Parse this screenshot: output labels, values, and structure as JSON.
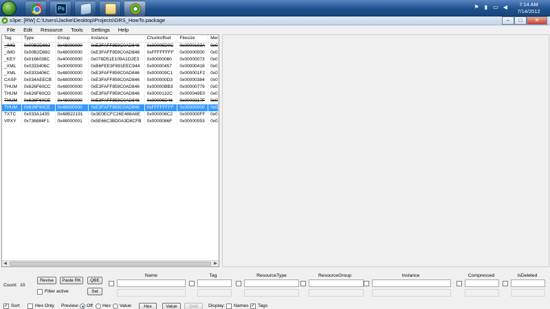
{
  "taskbar": {
    "apps": [
      "chrome-icon",
      "photoshop-icon",
      "document-icon",
      "folder-icon",
      "s3pe-icon"
    ],
    "ps_label": "Ps",
    "clock_time": "7:14 AM",
    "clock_date": "7/14/2012"
  },
  "window": {
    "title": "s3pe: [RW] C:\\Users\\Jackie\\Desktop\\Projects\\GRS_HowTo.package",
    "minimize": "–",
    "maximize": "□",
    "close": "✕"
  },
  "menu": [
    "File",
    "Edit",
    "Resource",
    "Tools",
    "Settings",
    "Help"
  ],
  "table": {
    "columns": [
      "Tag",
      "Type",
      "Group",
      "Instance",
      "Chunkoffset",
      "Filesize",
      "Mem"
    ],
    "rows": [
      {
        "tag": "_IMG",
        "type": "0x00B2D882",
        "group": "0x48000000",
        "instance": "0xE3FAFF859C0AD846",
        "chunk": "0x00005D0C",
        "size": "0x0000103A",
        "mem": "0x00",
        "strike": true
      },
      {
        "tag": "_IMG",
        "type": "0x00B2D882",
        "group": "0x48000000",
        "instance": "0xE3FAFF859C0AD846",
        "chunk": "0xFFFFFFFF",
        "size": "0x00000000",
        "mem": "0x00"
      },
      {
        "tag": "_KEY",
        "type": "0x0166038C",
        "group": "0x40000000",
        "instance": "0x078D51E109A1D2E3",
        "chunk": "0x00000060",
        "size": "0x00000073",
        "mem": "0x00"
      },
      {
        "tag": "_XML",
        "type": "0x0333406C",
        "group": "0x00000000",
        "instance": "0xB6FEE3F891EEC944",
        "chunk": "0x00000457",
        "size": "0x00000418",
        "mem": "0x00"
      },
      {
        "tag": "_XML",
        "type": "0x0333406C",
        "group": "0x48000000",
        "instance": "0xE3FAFF859C0AD846",
        "chunk": "0x000009C1",
        "size": "0x000001F2",
        "mem": "0x00"
      },
      {
        "tag": "CASP",
        "type": "0x034AEECB",
        "group": "0x48000000",
        "instance": "0xE3FAFF859C0AD846",
        "chunk": "0x000000D3",
        "size": "0x00000384",
        "mem": "0x00"
      },
      {
        "tag": "THUM",
        "type": "0x626F60CC",
        "group": "0x48000000",
        "instance": "0xE3FAFF859C0AD846",
        "chunk": "0x00000BB3",
        "size": "0x00000779",
        "mem": "0x00"
      },
      {
        "tag": "THUM",
        "type": "0x626F60CD",
        "group": "0x48000000",
        "instance": "0xE3FAFF859C0AD846",
        "chunk": "0x0000132C",
        "size": "0x000049E0",
        "mem": "0x00"
      },
      {
        "tag": "THUM",
        "type": "0x626F60CE",
        "group": "0x48000000",
        "instance": "0xE3FAFF859C0AD846",
        "chunk": "0x00006D46",
        "size": "0x0000217F",
        "mem": "0x00",
        "strike": true
      },
      {
        "tag": "THUM",
        "type": "0x626F60CE",
        "group": "0x48000000",
        "instance": "0xE3FAFF859C0AD846",
        "chunk": "0xFFFFFFFF",
        "size": "0x00000000",
        "mem": "0x00",
        "selected": true
      },
      {
        "tag": "TXTC",
        "type": "0x033A1435",
        "group": "0x48B22191",
        "instance": "0x3E0ECFC26E488A6E",
        "chunk": "0x000008C2",
        "size": "0x000000FF",
        "mem": "0x00"
      },
      {
        "tag": "VPXY",
        "type": "0x736884F1",
        "group": "0x48000001",
        "instance": "0x5E66C3BD0A3D8CFB",
        "chunk": "0x0000086F",
        "size": "0x00000053",
        "mem": "0x00"
      }
    ]
  },
  "bottom": {
    "count_label": "Count:",
    "count_value": "10",
    "revise": "Revise",
    "paste_rk": "Paste RK",
    "qbe": "QBE",
    "set": "Set",
    "filter_active": "Filter active",
    "headers": {
      "name": "Name",
      "tag": "Tag",
      "resource_type": "ResourceType",
      "resource_group": "ResourceGroup",
      "instance": "Instance",
      "compressed": "Compressed",
      "is_deleted": "IsDeleted"
    },
    "sort": "Sort",
    "hex_only": "Hex Only",
    "preview_label": "Preview:",
    "preview_off": "Off",
    "preview_hex": "Hex",
    "preview_value": "Value",
    "hex_btn": "Hex",
    "value_btn": "Value",
    "grid_btn": "Grid",
    "display_label": "Display:",
    "names": "Names",
    "tags": "Tags",
    "check_mark": "✓"
  }
}
